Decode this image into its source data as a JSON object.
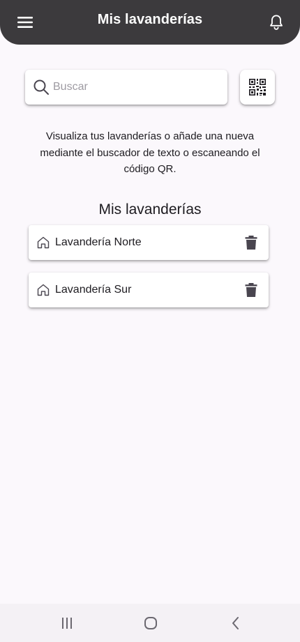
{
  "app_bar": {
    "title": "Mis lavanderías",
    "menu_icon": "menu-icon",
    "notification_icon": "bell-icon",
    "background": "#3c3a3d"
  },
  "search": {
    "placeholder": "Buscar",
    "value": "",
    "icon": "search-icon",
    "qr_icon": "qr-code-icon"
  },
  "help_text": "Visualiza tus lavanderías o añade una nueva mediante el buscador de texto o escaneando el código QR.",
  "section_title": "Mis lavanderías",
  "laundries": [
    {
      "name": "Lavandería Norte",
      "icon": "home-icon",
      "action_icon": "trash-icon"
    },
    {
      "name": "Lavandería Sur",
      "icon": "home-icon",
      "action_icon": "trash-icon"
    }
  ],
  "system_nav": {
    "recents_icon": "recents-icon",
    "home_icon": "home-circle-icon",
    "back_icon": "back-chevron-icon"
  }
}
